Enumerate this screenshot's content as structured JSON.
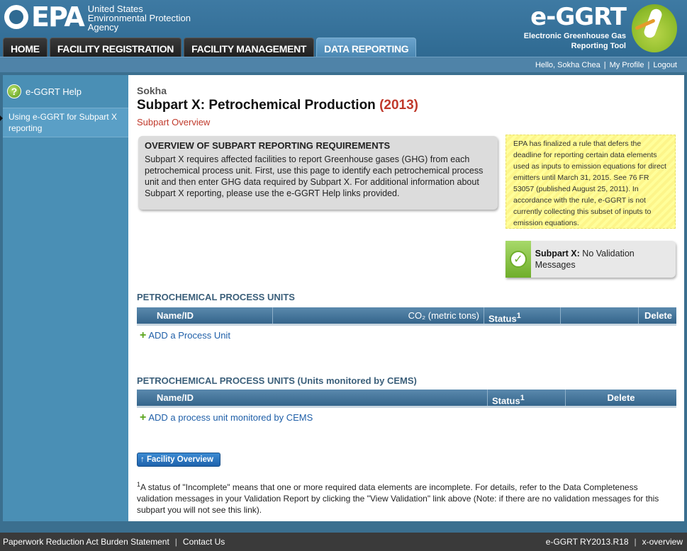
{
  "header": {
    "epa_name": "EPA",
    "agency_lines": [
      "United States",
      "Environmental Protection",
      "Agency"
    ],
    "app_title": "e-GGRT",
    "app_subtitle_lines": [
      "Electronic Greenhouse Gas",
      "Reporting Tool"
    ]
  },
  "nav": {
    "tabs": [
      {
        "label": "HOME"
      },
      {
        "label": "FACILITY REGISTRATION"
      },
      {
        "label": "FACILITY MANAGEMENT"
      },
      {
        "label": "DATA REPORTING"
      }
    ]
  },
  "userbar": {
    "greeting": "Hello, Sokha Chea",
    "profile": "My Profile",
    "logout": "Logout"
  },
  "sidebar": {
    "help_label": "e-GGRT Help",
    "help_icon": "?",
    "link": "Using e-GGRT for Subpart X reporting"
  },
  "main": {
    "facility": "Sokha",
    "title": "Subpart X: Petrochemical Production",
    "year": "(2013)",
    "subtitle": "Subpart Overview",
    "overview_heading": "OVERVIEW OF SUBPART REPORTING REQUIREMENTS",
    "overview_text": "Subpart X requires affected facilities to report Greenhouse gases (GHG) from each petrochemical process unit. First, use this page to identify each petrochemical process unit and then enter GHG data required by Subpart X. For additional information about Subpart X reporting, please use the e-GGRT Help links provided.",
    "notice": "EPA has finalized a rule that defers the deadline for reporting certain data elements used as inputs to emission equations for direct emitters until March 31, 2015. See 76 FR 53057 (published August 25, 2011). In accordance with the rule, e-GGRT is not currently collecting this subset of inputs to emission equations.",
    "validation_label": "Subpart X:",
    "validation_text": "No Validation Messages",
    "section1_title": "PETROCHEMICAL PROCESS UNITS",
    "section1_columns": [
      "Name/ID",
      "CO₂ (metric tons)",
      "Status",
      "",
      "Delete"
    ],
    "section1_add": "ADD a Process Unit",
    "section2_title": "PETROCHEMICAL PROCESS UNITS (Units monitored by CEMS)",
    "section2_columns": [
      "Name/ID",
      "Status",
      "Delete"
    ],
    "section2_add": "ADD a process unit monitored by CEMS",
    "facility_button": "Facility Overview",
    "footnote_marker": "1",
    "footnote": "A status of \"Incomplete\" means that one or more required data elements are incomplete. For details, refer to the Data Completeness validation messages in your Validation Report by clicking the \"View Validation\" link above (Note: if there are no validation messages for this subpart you will not see this link)."
  },
  "footer": {
    "paperwork": "Paperwork Reduction Act Burden Statement",
    "contact": "Contact Us",
    "version": "e-GGRT RY2013.R18",
    "page_id": "x-overview"
  }
}
